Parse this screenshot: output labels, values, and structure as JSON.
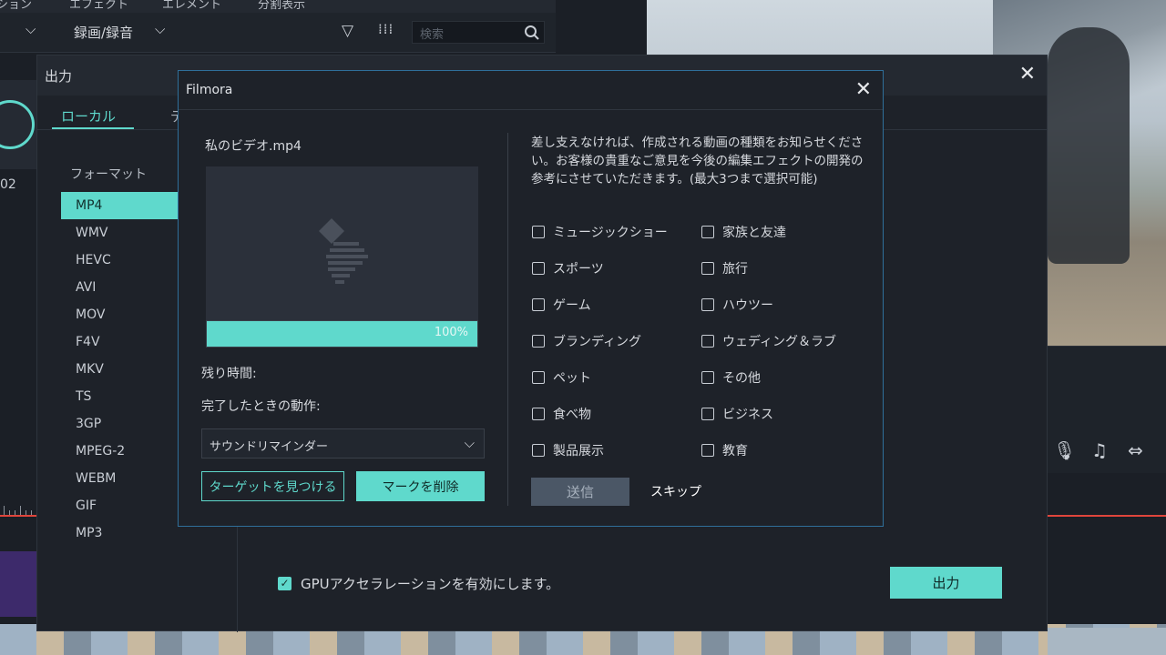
{
  "background": {
    "menu": [
      "ション",
      "エフェクト",
      "エレメント",
      "分割表示"
    ],
    "toolbar": {
      "record_label": "録画/録音"
    },
    "search": {
      "placeholder": "検索"
    },
    "number_label": "02"
  },
  "output_dialog": {
    "title": "出力",
    "tabs": {
      "local": "ローカル",
      "device": "デ"
    },
    "format_label": "フォーマット",
    "formats": [
      "MP4",
      "WMV",
      "HEVC",
      "AVI",
      "MOV",
      "F4V",
      "MKV",
      "TS",
      "3GP",
      "MPEG-2",
      "WEBM",
      "GIF",
      "MP3"
    ],
    "selected_format": "MP4",
    "gpu_label": "GPUアクセラレーションを有効にします。",
    "gpu_checked": true,
    "export_label": "出力"
  },
  "filmora_dialog": {
    "title": "Filmora",
    "file_name": "私のビデオ.mp4",
    "progress_text": "100%",
    "progress": 1.0,
    "remaining_label": "残り時間:",
    "complete_action_label": "完了したときの動作:",
    "complete_action_value": "サウンドリマインダー",
    "find_target_label": "ターゲットを見つける",
    "remove_mark_label": "マークを削除",
    "survey_text": "差し支えなければ、作成される動画の種類をお知らせください。お客様の貴重なご意見を今後の編集エフェクトの開発の参考にさせていただきます。(最大3つまで選択可能)",
    "options_left": [
      "ミュージックショー",
      "スポーツ",
      "ゲーム",
      "ブランディング",
      "ペット",
      "食べ物",
      "製品展示"
    ],
    "options_right": [
      "家族と友達",
      "旅行",
      "ハウツー",
      "ウェディング＆ラブ",
      "その他",
      "ビジネス",
      "教育"
    ],
    "send_label": "送信",
    "skip_label": "スキップ"
  },
  "colors": {
    "accent": "#5fd9cc",
    "dialog_border": "#2f6f9a",
    "background": "#1e2229",
    "send_disabled": "#4b5766"
  }
}
